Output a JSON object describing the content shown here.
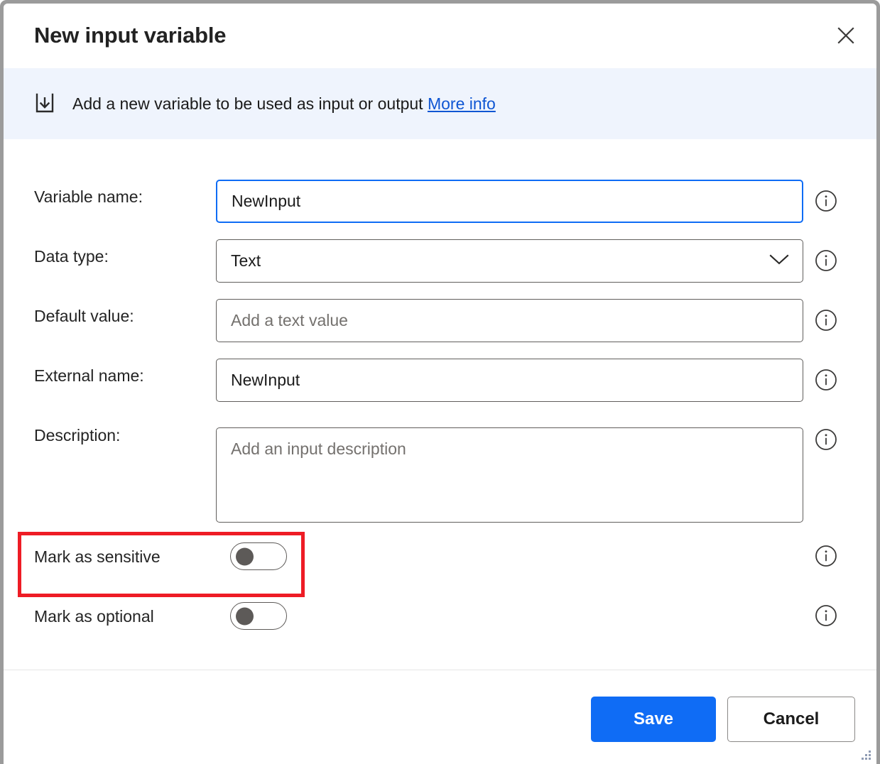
{
  "window": {
    "title": "New input variable",
    "close_icon": "close-icon",
    "resize_grip_icon": "resize-grip-icon"
  },
  "banner": {
    "icon": "input-variable-icon",
    "text": "Add a new variable to be used as input or output",
    "link_label": "More info",
    "background_color": "#eff4fd",
    "link_color": "#0f56d3"
  },
  "form": {
    "fields": [
      {
        "label": "Variable name:",
        "value": "NewInput",
        "placeholder": "",
        "focused": true,
        "info_icon": "info-icon"
      },
      {
        "label": "Data type:",
        "value": "Text",
        "placeholder": "",
        "focused": false,
        "dropdown_icon": "chevron-down-icon",
        "info_icon": "info-icon"
      },
      {
        "label": "Default value:",
        "value": "",
        "placeholder": "Add a text value",
        "focused": false,
        "info_icon": "info-icon"
      },
      {
        "label": "External name:",
        "value": "NewInput",
        "placeholder": "",
        "focused": false,
        "info_icon": "info-icon"
      },
      {
        "label": "Description:",
        "value": "",
        "placeholder": "Add an input description",
        "focused": false,
        "info_icon": "info-icon"
      }
    ],
    "toggles": [
      {
        "label": "Mark as sensitive",
        "state": "off",
        "highlighted": true,
        "info_icon": "info-icon"
      },
      {
        "label": "Mark as optional",
        "state": "off",
        "highlighted": false,
        "info_icon": "info-icon"
      }
    ]
  },
  "footer": {
    "save_label": "Save",
    "cancel_label": "Cancel"
  },
  "colors": {
    "accent": "#0f6cf5",
    "annotation": "#ee1c25",
    "field_border": "#605e5c",
    "placeholder_text": "#74716e"
  }
}
